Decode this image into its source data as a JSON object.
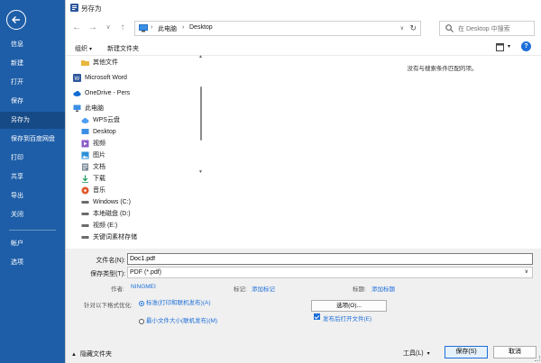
{
  "backstage": {
    "items": [
      {
        "label": "信息"
      },
      {
        "label": "新建"
      },
      {
        "label": "打开"
      },
      {
        "label": "保存"
      },
      {
        "label": "另存为",
        "active": true
      },
      {
        "label": "保存到百度网盘"
      },
      {
        "label": "打印"
      },
      {
        "label": "共享"
      },
      {
        "label": "导出"
      },
      {
        "label": "关闭"
      },
      {
        "label": "帐户"
      },
      {
        "label": "选项"
      }
    ]
  },
  "dialog": {
    "title": "另存为",
    "address": {
      "crumbs": [
        "此电脑",
        "Desktop"
      ]
    },
    "search": {
      "placeholder": "在 Desktop 中搜索"
    },
    "toolbar": {
      "organize": "组织",
      "new_folder": "新建文件夹"
    },
    "nav_items": [
      {
        "label": "其他文件",
        "icon": "folder-icon"
      },
      {
        "label": "Microsoft Word",
        "icon": "word-icon"
      },
      {
        "label": "OneDrive - Pers",
        "icon": "cloud-icon"
      },
      {
        "label": "此电脑",
        "icon": "computer-icon"
      },
      {
        "label": "WPS云盘",
        "icon": "wps-cloud-icon"
      },
      {
        "label": "Desktop",
        "icon": "desktop-icon"
      },
      {
        "label": "视频",
        "icon": "video-icon"
      },
      {
        "label": "图片",
        "icon": "pictures-icon"
      },
      {
        "label": "文档",
        "icon": "documents-icon"
      },
      {
        "label": "下载",
        "icon": "download-icon"
      },
      {
        "label": "音乐",
        "icon": "music-icon"
      },
      {
        "label": "Windows (C:)",
        "icon": "drive-icon"
      },
      {
        "label": "本地磁盘 (D:)",
        "icon": "drive-icon"
      },
      {
        "label": "视频 (E:)",
        "icon": "drive-icon"
      },
      {
        "label": "关键词素材存储",
        "icon": "drive-icon"
      }
    ],
    "empty_message": "没有与搜索条件匹配的项。",
    "form": {
      "filename_label": "文件名(N):",
      "filename_value": "Doc1.pdf",
      "filetype_label": "保存类型(T):",
      "filetype_value": "PDF (*.pdf)",
      "author_label": "作者:",
      "author_value": "NINGMEI",
      "tags_label": "标记:",
      "tags_link": "添加标记",
      "title_label": "标题:",
      "title_link": "添加标题",
      "optimize_label": "针对以下格式优化:",
      "radio_standard": "标准(打印和联机发布)(A)",
      "radio_minimum": "最小文件大小(联机发布)(M)",
      "options_button": "选项(O)...",
      "open_after_label": "发布后打开文件(E)"
    },
    "footer": {
      "hide_folders": "隐藏文件夹",
      "tools": "工具(L)",
      "save": "保存(S)",
      "cancel": "取消"
    }
  },
  "colors": {
    "backstage_blue": "#1e5ea8",
    "backstage_active": "#164a86",
    "accent": "#1e6fd9"
  }
}
